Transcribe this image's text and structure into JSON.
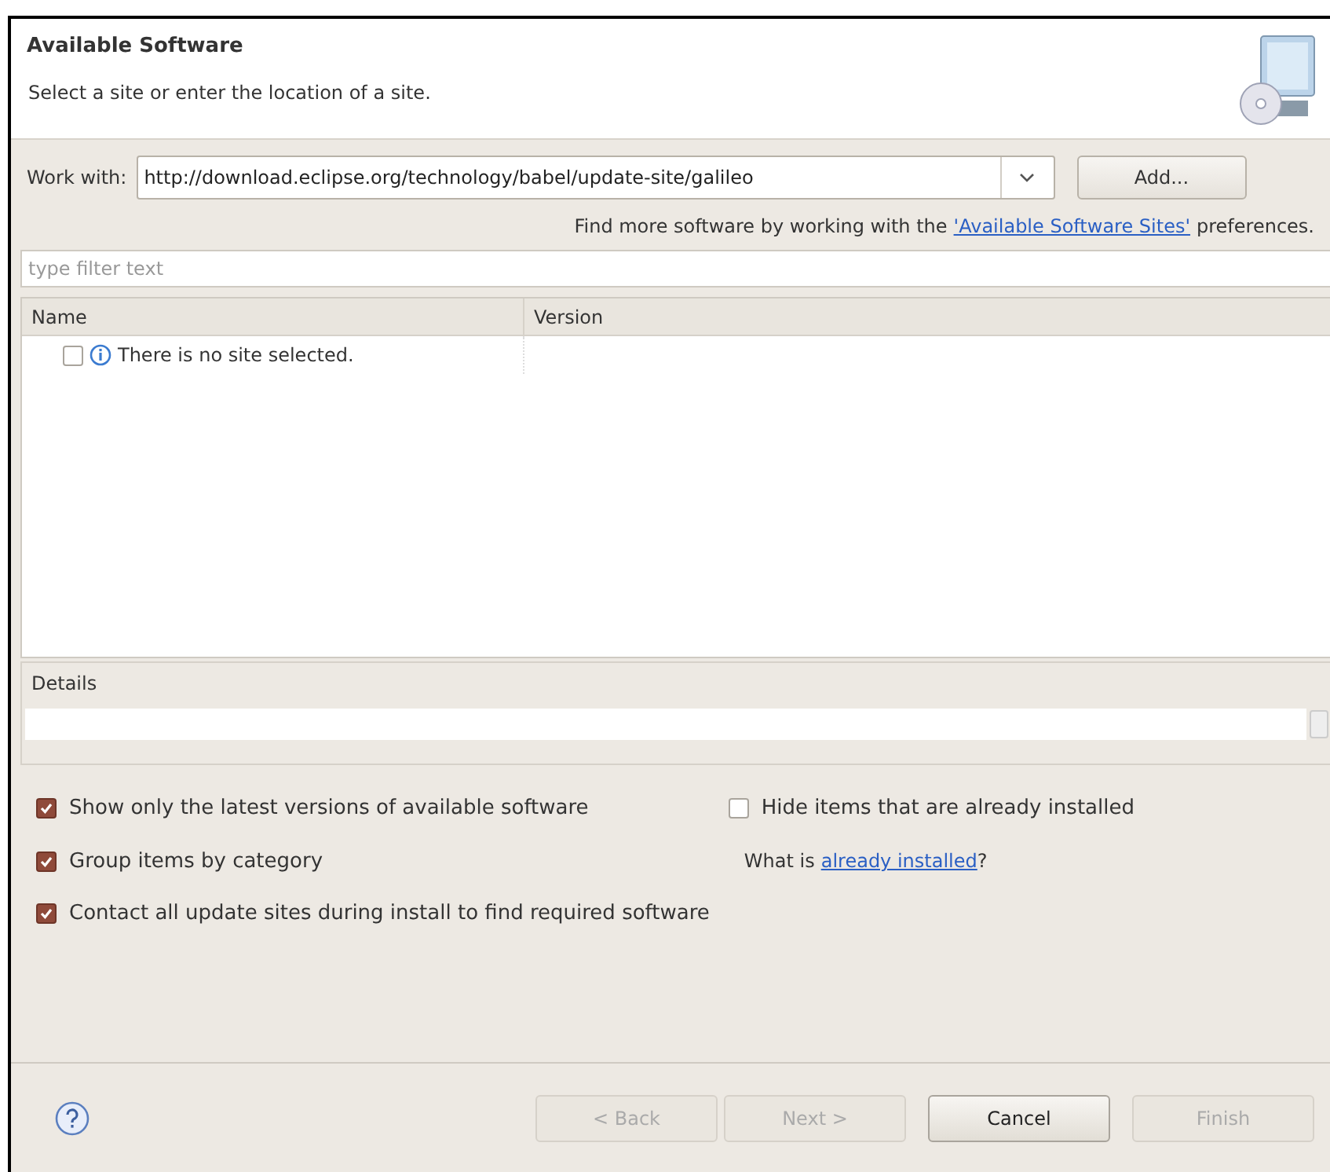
{
  "header": {
    "title": "Available Software",
    "subtitle": "Select a site or enter the location of a site."
  },
  "work_with": {
    "label": "Work with:",
    "value": "http://download.eclipse.org/technology/babel/update-site/galileo",
    "add_button": "Add..."
  },
  "find_more": {
    "before": "Find more software by working with the",
    "link": "'Available Software Sites'",
    "after": "preferences."
  },
  "filter": {
    "placeholder": "type filter text"
  },
  "table": {
    "columns": [
      "Name",
      "Version"
    ],
    "rows": [
      {
        "name": "There is no site selected.",
        "checked": false
      }
    ]
  },
  "details": {
    "label": "Details"
  },
  "options": [
    {
      "label": "Show only the latest versions of available software",
      "checked": true
    },
    {
      "label": "Hide items that are already installed",
      "checked": false
    },
    {
      "label": "Group items by category",
      "checked": true
    },
    {
      "label": "Contact all update sites during install to find required software",
      "checked": true
    }
  ],
  "installed": {
    "before": "What is",
    "link": "already installed",
    "after": "?"
  },
  "buttons": [
    {
      "label": "< Back",
      "disabled": true
    },
    {
      "label": "Next >",
      "disabled": true
    },
    {
      "label": "Cancel",
      "disabled": false
    },
    {
      "label": "Finish",
      "disabled": true
    }
  ]
}
